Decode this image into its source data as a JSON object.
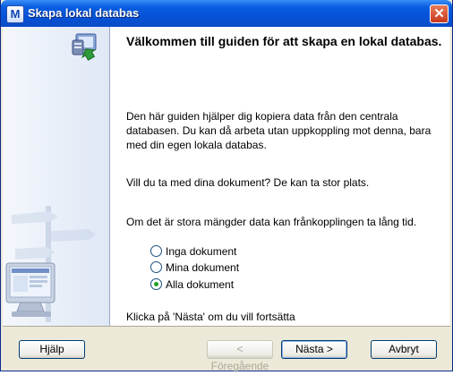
{
  "window": {
    "title": "Skapa lokal databas",
    "app_icon_letter": "M",
    "close_glyph": "✕"
  },
  "main": {
    "heading": "Välkommen till guiden för att skapa en lokal databas.",
    "intro": "Den här guiden hjälper dig kopiera data från den centrala databasen. Du kan då arbeta utan uppkoppling mot denna, bara med din egen lokala databas.",
    "question": "Vill du ta med dina dokument? De kan ta stor plats.",
    "warning": "Om det är stora mängder data kan frånkopplingen ta lång tid.",
    "options": [
      {
        "label": "Inga dokument",
        "selected": false
      },
      {
        "label": "Mina dokument",
        "selected": false
      },
      {
        "label": "Alla dokument",
        "selected": true
      }
    ],
    "hint": "Klicka på 'Nästa' om du vill fortsätta"
  },
  "buttons": {
    "help": "Hjälp",
    "previous": "< Föregående",
    "next": "Nästa >",
    "cancel": "Avbryt"
  },
  "icons": {
    "top": "computer-database-icon",
    "side": "signpost-computer-illustration"
  },
  "colors": {
    "title_bar": "#0a5fe0",
    "dialog_bg": "#ece9d8",
    "side_panel": "#dfe8f6",
    "radio_dot": "#21a121"
  }
}
